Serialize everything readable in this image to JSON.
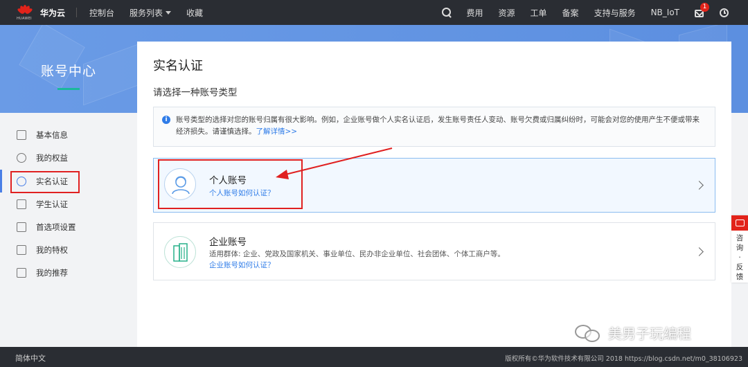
{
  "topbar": {
    "logo_text": "HUAWEI",
    "brand": "华为云",
    "nav": [
      "控制台",
      "服务列表",
      "收藏"
    ],
    "right": [
      "费用",
      "资源",
      "工单",
      "备案",
      "支持与服务",
      "NB_IoT"
    ],
    "notification_count": "1",
    "icons": [
      "search-icon",
      "mail-icon",
      "clock-icon"
    ]
  },
  "sidebar": {
    "title": "账号中心",
    "items": [
      {
        "label": "基本信息",
        "icon": "profile-card-icon"
      },
      {
        "label": "我的权益",
        "icon": "diamond-icon"
      },
      {
        "label": "实名认证",
        "icon": "user-icon",
        "active": true
      },
      {
        "label": "学生认证",
        "icon": "student-icon"
      },
      {
        "label": "首选项设置",
        "icon": "sliders-icon"
      },
      {
        "label": "我的特权",
        "icon": "crown-icon"
      },
      {
        "label": "我的推荐",
        "icon": "thumbs-up-icon"
      }
    ]
  },
  "main": {
    "title": "实名认证",
    "subtitle": "请选择一种账号类型",
    "notice": {
      "text": "账号类型的选择对您的账号归属有很大影响。例如，企业账号做个人实名认证后，发生账号责任人变动、账号欠费或归属纠纷时，可能会对您的使用产生不便或带来经济损失。请谨慎选择。",
      "link": "了解详情>>"
    },
    "personal": {
      "title": "个人账号",
      "link": "个人账号如何认证？"
    },
    "enterprise": {
      "title": "企业账号",
      "desc": "适用群体: 企业、党政及国家机关、事业单位、民办非企业单位、社会团体、个体工商户等。",
      "link": "企业账号如何认证？"
    }
  },
  "feedback": {
    "label": "咨询·反馈"
  },
  "footer": {
    "lang": "简体中文",
    "copyright": "版权所有©华为软件技术有限公司 2018 https://blog.csdn.net/m0_38106923"
  },
  "watermark": {
    "text": "美男子玩编程"
  },
  "colors": {
    "accent": "#2f7ce8",
    "brand_red": "#e2231a",
    "annotation_red": "#e02020",
    "banner_blue": "#6a9be6"
  }
}
